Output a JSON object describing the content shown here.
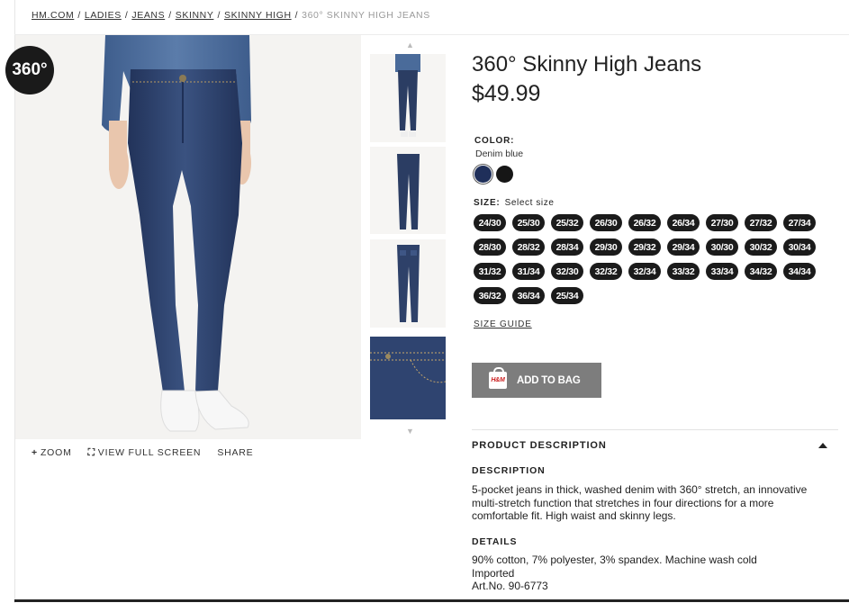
{
  "breadcrumb": {
    "items": [
      "HM.COM",
      "LADIES",
      "JEANS",
      "SKINNY",
      "SKINNY HIGH"
    ],
    "separator": "/",
    "current": "360° SKINNY HIGH JEANS"
  },
  "gallery": {
    "badge": "360°",
    "tools": {
      "zoom": "ZOOM",
      "full_screen": "VIEW FULL SCREEN",
      "share": "SHARE"
    },
    "thumbnail_count": 4
  },
  "product": {
    "title": "360° Skinny High Jeans",
    "price": "$49.99",
    "color_label": "COLOR:",
    "color_value": "Denim blue",
    "swatches": [
      {
        "name": "Denim blue",
        "hex": "#1f2f5a",
        "selected": true
      },
      {
        "name": "Black",
        "hex": "#161616",
        "selected": false
      }
    ],
    "size_label": "SIZE:",
    "size_prompt": "Select size",
    "sizes": [
      "24/30",
      "25/30",
      "25/32",
      "26/30",
      "26/32",
      "26/34",
      "27/30",
      "27/32",
      "27/34",
      "28/30",
      "28/32",
      "28/34",
      "29/30",
      "29/32",
      "29/34",
      "30/30",
      "30/32",
      "30/34",
      "31/32",
      "31/34",
      "32/30",
      "32/32",
      "32/34",
      "33/32",
      "33/34",
      "34/32",
      "34/34",
      "36/32",
      "36/34",
      "25/34"
    ],
    "size_guide": "SIZE GUIDE",
    "add_to_bag": "ADD TO BAG",
    "bag_logo": "H&M"
  },
  "description": {
    "header": "PRODUCT DESCRIPTION",
    "description_heading": "DESCRIPTION",
    "description_text": "5-pocket jeans in thick, washed denim with 360° stretch, an innovative multi-stretch function that stretches in four directions for a more comfortable fit. High waist and skinny legs.",
    "details_heading": "DETAILS",
    "details_lines": [
      "90% cotton, 7% polyester, 3% spandex. Machine wash cold",
      "Imported",
      "Art.No. 90-6773"
    ]
  },
  "colors": {
    "accent_dark": "#1b1b1b",
    "button_gray": "#7d7d7d",
    "denim": "#2b3d63"
  }
}
